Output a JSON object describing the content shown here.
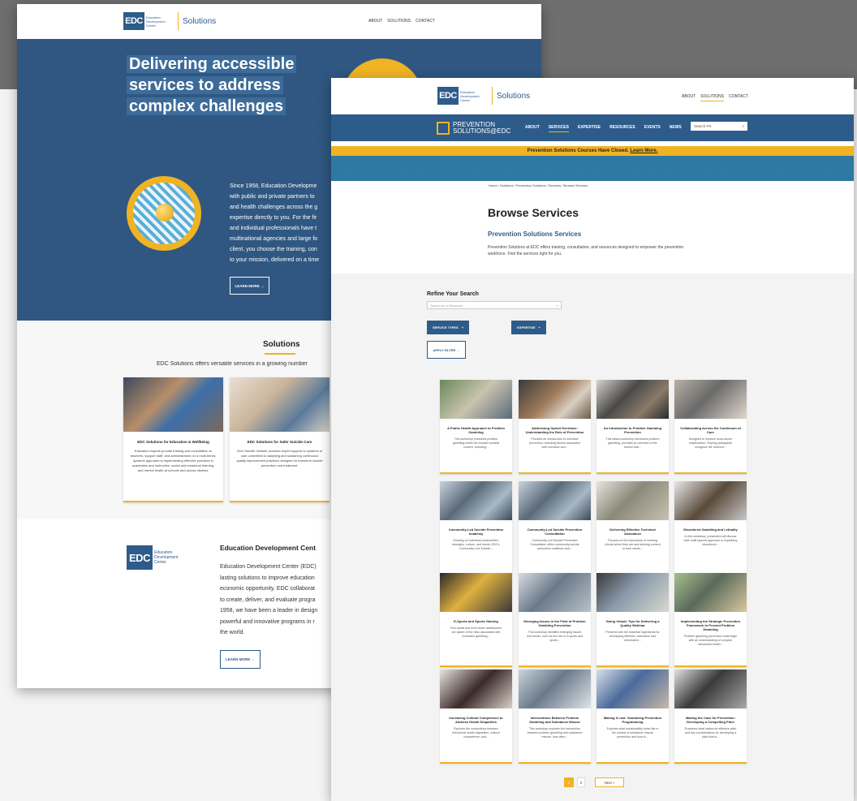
{
  "colors": {
    "brand_blue": "#2d5b8a",
    "accent_gold": "#f0b323",
    "hero_blue": "#2f5781",
    "band_blue": "#2e78a3"
  },
  "brand": {
    "logo": "EDC",
    "sub": "Education Development Center",
    "product": "Solutions"
  },
  "page_a": {
    "nav": [
      "ABOUT",
      "SOLUTIONS",
      "CONTACT"
    ],
    "hero_title": "Delivering accessible services to address complex challenges",
    "intro": {
      "lines": [
        "Since 1958, Education Developme",
        "with public and private partners to",
        "and health challenges across the g",
        "expertise directly to you. For the fir",
        "and individual professionals have t",
        "multinational agencies and large fo",
        "client, you choose the training, con",
        "to your mission, delivered on a time"
      ],
      "button": "LEARN MORE →"
    },
    "solutions": {
      "title": "Solutions",
      "subtitle": "EDC Solutions offers versatile services in a growing number",
      "cards": [
        {
          "title": "EDC Solutions for Education & Wellbeing",
          "text": "Education experts provide training and consultation to teachers, support staff, and administrators on a multi-tiered, systems approach to implementing effective practices in academics and instruction, social and emotional learning, and mental health at schools and across districts."
        },
        {
          "title": "EDC Solutions for Safer Suicide Care",
          "text": "Zero Suicide Institute provides expert support to systems of care committed to adopting and sustaining continuous quality improvement practices designed to transform suicide prevention and treatment."
        }
      ]
    },
    "org": {
      "title": "Education Development Cent",
      "lines": [
        "Education Development Center (EDC)",
        "lasting solutions to improve education",
        "economic opportunity. EDC collaborat",
        "to create, deliver, and evaluate progra",
        "1958, we have been a leader in design",
        "powerful and innovative programs in r",
        "the world."
      ],
      "button": "LEARN MORE →"
    }
  },
  "page_b": {
    "nav": [
      "ABOUT",
      "SOLUTIONS",
      "CONTACT"
    ],
    "ps_name": [
      "PREVENTION",
      "SOLUTIONS@EDC"
    ],
    "ps_menu": [
      "ABOUT",
      "SERVICES",
      "EXPERTISE",
      "RESOURCES",
      "EVENTS",
      "NEWS"
    ],
    "search_placeholder": "Search PS",
    "banner_text": "Prevention Solutions Courses Have Closed. ",
    "banner_link": "Learn More.",
    "breadcrumb": "Home / Solutions / Prevention Solutions / Services / Browse Services",
    "title": "Browse Services",
    "subtitle": "Prevention Solutions Services",
    "description": "Prevention Solutions at EDC offers training, consultation, and resources designed to empower the prevention workforce. Find the services right for you.",
    "refine": {
      "title": "Refine Your Search",
      "placeholder": "Search for a Resource",
      "service_types": "SERVICE TYPES",
      "expertise": "EXPERTISE",
      "apply": "APPLY FILTER →"
    },
    "cards": [
      {
        "title": "A Public Health Approach to Problem Gambling",
        "text": "This workshop examines problem gambling within the broader societal context, including..."
      },
      {
        "title": "Addressing Opioid Overdose: Understanding the Role of Prevention",
        "text": "Provides an introduction to overdose prevention, including factors associated with overdose and..."
      },
      {
        "title": "An Introduction to Problem Gambling Prevention",
        "text": "This basics workshop introduces problem gambling, provides an overview of the factors that..."
      },
      {
        "title": "Collaborating Across the Continuum of Care",
        "text": "Designed to improve cross-sector collaboration, helping participants recognize the inherent..."
      },
      {
        "title": "Community-Led Suicide Prevention Academy",
        "text": "Drawing on individual communities' strengths, culture, and needs, EDC's Community-Led Suicide..."
      },
      {
        "title": "Community-Led Suicide Prevention Consultation",
        "text": "Community-Led Suicide Prevention Consultation offers community suicide prevention coalitions and..."
      },
      {
        "title": "Delivering Effective Technical Assistance",
        "text": "Focuses on the importance of meeting clients where they are and tailoring content to their needs..."
      },
      {
        "title": "Disordered Gambling and Lethality",
        "text": "In this workshop, presenters will discuss their multi-layered approach to explaining disordered..."
      },
      {
        "title": "E-Sports and Sports Gaming",
        "text": "Few adults and even fewer adolescents are aware of the risks associated with excessive gambling..."
      },
      {
        "title": "Emerging Issues in the Field of Problem Gambling Prevention",
        "text": "This workshop identifies emerging issues and trends, such as the rise in e-sports and sports..."
      },
      {
        "title": "Going Virtual: Tips for Delivering a Quality Webinar",
        "text": "Presents with the essential ingredients for developing effective, interactive and informative..."
      },
      {
        "title": "Implementing the Strategic Prevention Framework to Prevent Problem Gambling",
        "text": "Problem gambling prevention must begin with an understanding of complex behavioral health..."
      },
      {
        "title": "Increasing Cultural Competence to Address Health Disparities",
        "text": "Explores the connections between behavioral health disparities, cultural competence, and..."
      },
      {
        "title": "Intersections Between Problem Gambling and Substance Misuse",
        "text": "This workshop explores the intersection between problem gambling and substance misuse, how often..."
      },
      {
        "title": "Making it Last: Sustaining Prevention Programming",
        "text": "Explores what sustainability looks like in the context of substance misuse prevention and how to..."
      },
      {
        "title": "Making the Case for Prevention: Developing a Compelling Pitch",
        "text": "Examines what makes an effective pitch and key considerations for developing a pitch that is..."
      }
    ],
    "pagination": {
      "page1": "1",
      "page2": "2",
      "next": "Next »"
    }
  }
}
